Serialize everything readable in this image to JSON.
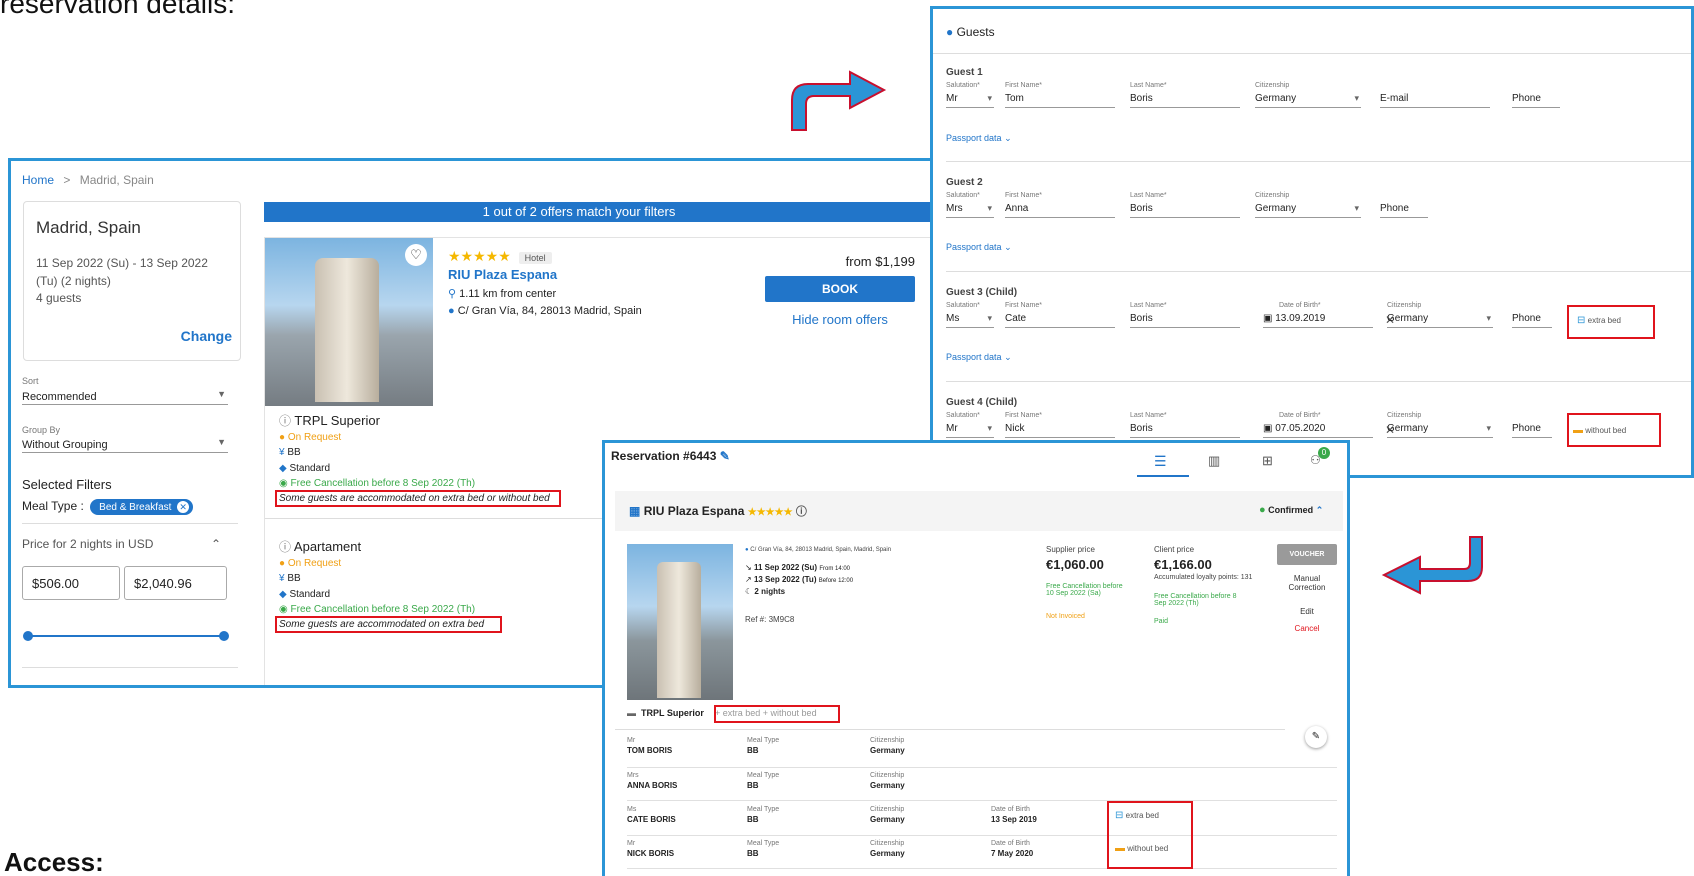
{
  "doc": {
    "top_text": "reservation details:",
    "bottom_heading": "Access:"
  },
  "search": {
    "breadcrumb_home": "Home",
    "breadcrumb_sep": ">",
    "breadcrumb_current": "Madrid, Spain",
    "destination": "Madrid, Spain",
    "dates_line1": "11 Sep 2022 (Su) - 13 Sep 2022",
    "dates_line2": "(Tu) (2 nights)",
    "guests": "4 guests",
    "change": "Change",
    "sort_label": "Sort",
    "sort_value": "Recommended",
    "group_label": "Group By",
    "group_value": "Without Grouping",
    "selected_filters": "Selected Filters",
    "meal_type_label": "Meal Type :",
    "meal_chip": "Bed & Breakfast",
    "price_title": "Price for 2 nights in USD",
    "price_min": "$506.00",
    "price_max": "$2,040.96",
    "offers_banner": "1 out of 2 offers match your filters",
    "hotel": {
      "badge": "Hotel",
      "name": "RIU Plaza Espana",
      "distance": "1.11 km from center",
      "address": "C/ Gran Vía, 84, 28013 Madrid, Spain",
      "price_from": "from $1,199",
      "book": "BOOK",
      "hide_offers": "Hide room offers",
      "stars": 5
    },
    "rooms": [
      {
        "name": "TRPL Superior",
        "status": "On Request",
        "meal": "BB",
        "rate": "Standard",
        "cancel": "Free Cancellation before 8 Sep 2022 (Th)",
        "note": "Some guests are accommodated on extra bed or without bed"
      },
      {
        "name": "Apartament",
        "status": "On Request",
        "meal": "BB",
        "rate": "Standard",
        "cancel": "Free Cancellation before 8 Sep 2022 (Th)",
        "note": "Some guests are accommodated on extra bed"
      }
    ]
  },
  "guests": {
    "title": "Guests",
    "labels": {
      "salutation": "Salutation*",
      "first": "First Name*",
      "last": "Last Name*",
      "citizenship": "Citizenship",
      "dob": "Date of Birth*",
      "email": "E-mail",
      "phone": "Phone",
      "passport": "Passport data"
    },
    "list": [
      {
        "title": "Guest 1",
        "salutation": "Mr",
        "first": "Tom",
        "last": "Boris",
        "citizenship": "Germany"
      },
      {
        "title": "Guest 2",
        "salutation": "Mrs",
        "first": "Anna",
        "last": "Boris",
        "citizenship": "Germany"
      },
      {
        "title": "Guest 3 (Child)",
        "salutation": "Ms",
        "first": "Cate",
        "last": "Boris",
        "dob": "13.09.2019",
        "citizenship": "Germany",
        "bed": "extra bed"
      },
      {
        "title": "Guest 4 (Child)",
        "salutation": "Mr",
        "first": "Nick",
        "last": "Boris",
        "dob": "07.05.2020",
        "citizenship": "Germany",
        "bed": "without bed"
      }
    ]
  },
  "reservation": {
    "title": "Reservation #6443",
    "notif_count": "0",
    "hotel_name": "RIU Plaza Espana",
    "status": "Confirmed",
    "address": "C/ Gran Vía, 84, 28013 Madrid, Spain, Madrid, Spain",
    "checkin_date": "11 Sep 2022 (Su)",
    "checkin_time": "From 14:00",
    "checkout_date": "13 Sep 2022 (Tu)",
    "checkout_time": "Before 12:00",
    "nights": "2 nights",
    "ref": "Ref #: 3M9C8",
    "supplier_label": "Supplier price",
    "supplier_price": "€1,060.00",
    "supplier_cancel": "Free Cancellation before 10 Sep 2022 (Sa)",
    "supplier_invoice": "Not Invoiced",
    "client_label": "Client price",
    "client_price": "€1,166.00",
    "loyalty": "Accumulated loyalty points: 131",
    "client_cancel": "Free Cancellation before 8 Sep 2022 (Th)",
    "client_paid": "Paid",
    "voucher": "VOUCHER",
    "manual": "Manual Correction",
    "edit": "Edit",
    "cancel": "Cancel",
    "room_name": "TRPL Superior",
    "room_suffix": "+ extra bed + without bed",
    "labels": {
      "meal": "Meal Type",
      "citizenship": "Citizenship",
      "dob": "Date of Birth"
    },
    "rows": [
      {
        "sal": "Mr",
        "name": "TOM BORIS",
        "meal": "BB",
        "cit": "Germany"
      },
      {
        "sal": "Mrs",
        "name": "ANNA BORIS",
        "meal": "BB",
        "cit": "Germany"
      },
      {
        "sal": "Ms",
        "name": "CATE BORIS",
        "meal": "BB",
        "cit": "Germany",
        "dob": "13 Sep 2019",
        "bed": "extra bed"
      },
      {
        "sal": "Mr",
        "name": "NICK BORIS",
        "meal": "BB",
        "cit": "Germany",
        "dob": "7 May 2020",
        "bed": "without bed"
      }
    ]
  },
  "colors": {
    "panel_border": "#2b95d6",
    "primary": "#2175c9",
    "highlight": "#e0141c",
    "green": "#3aa94a",
    "orange": "#f0a015"
  }
}
